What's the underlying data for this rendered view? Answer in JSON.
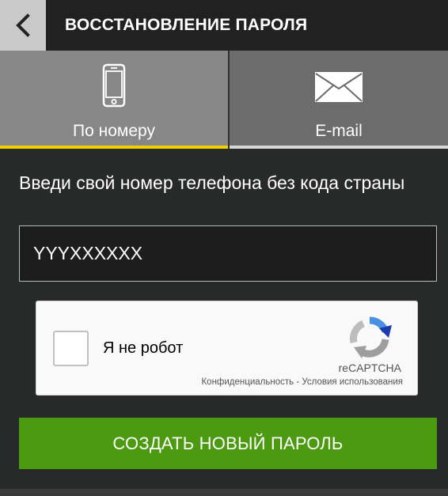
{
  "header": {
    "back_icon": "chevron-left-icon",
    "title": "ВОССТАНОВЛЕНИЕ ПАРОЛЯ"
  },
  "tabs": [
    {
      "label": "По номеру",
      "icon": "smartphone-icon",
      "selected": true
    },
    {
      "label": "E-mail",
      "icon": "envelope-icon",
      "selected": false
    }
  ],
  "form": {
    "instruction": "Введи свой номер телефона без кода страны",
    "phone_value": "YYYXXXXXX"
  },
  "captcha": {
    "label": "Я не робот",
    "brand": "reCAPTCHA",
    "privacy": "Конфиденциальность",
    "separator": " - ",
    "terms": "Условия использования",
    "checked": false
  },
  "submit": {
    "label": "СОЗДАТЬ НОВЫЙ ПАРОЛЬ"
  },
  "colors": {
    "accent_yellow": "#f2cf00",
    "button_green": "#4b9a0f",
    "background": "#272a29"
  }
}
